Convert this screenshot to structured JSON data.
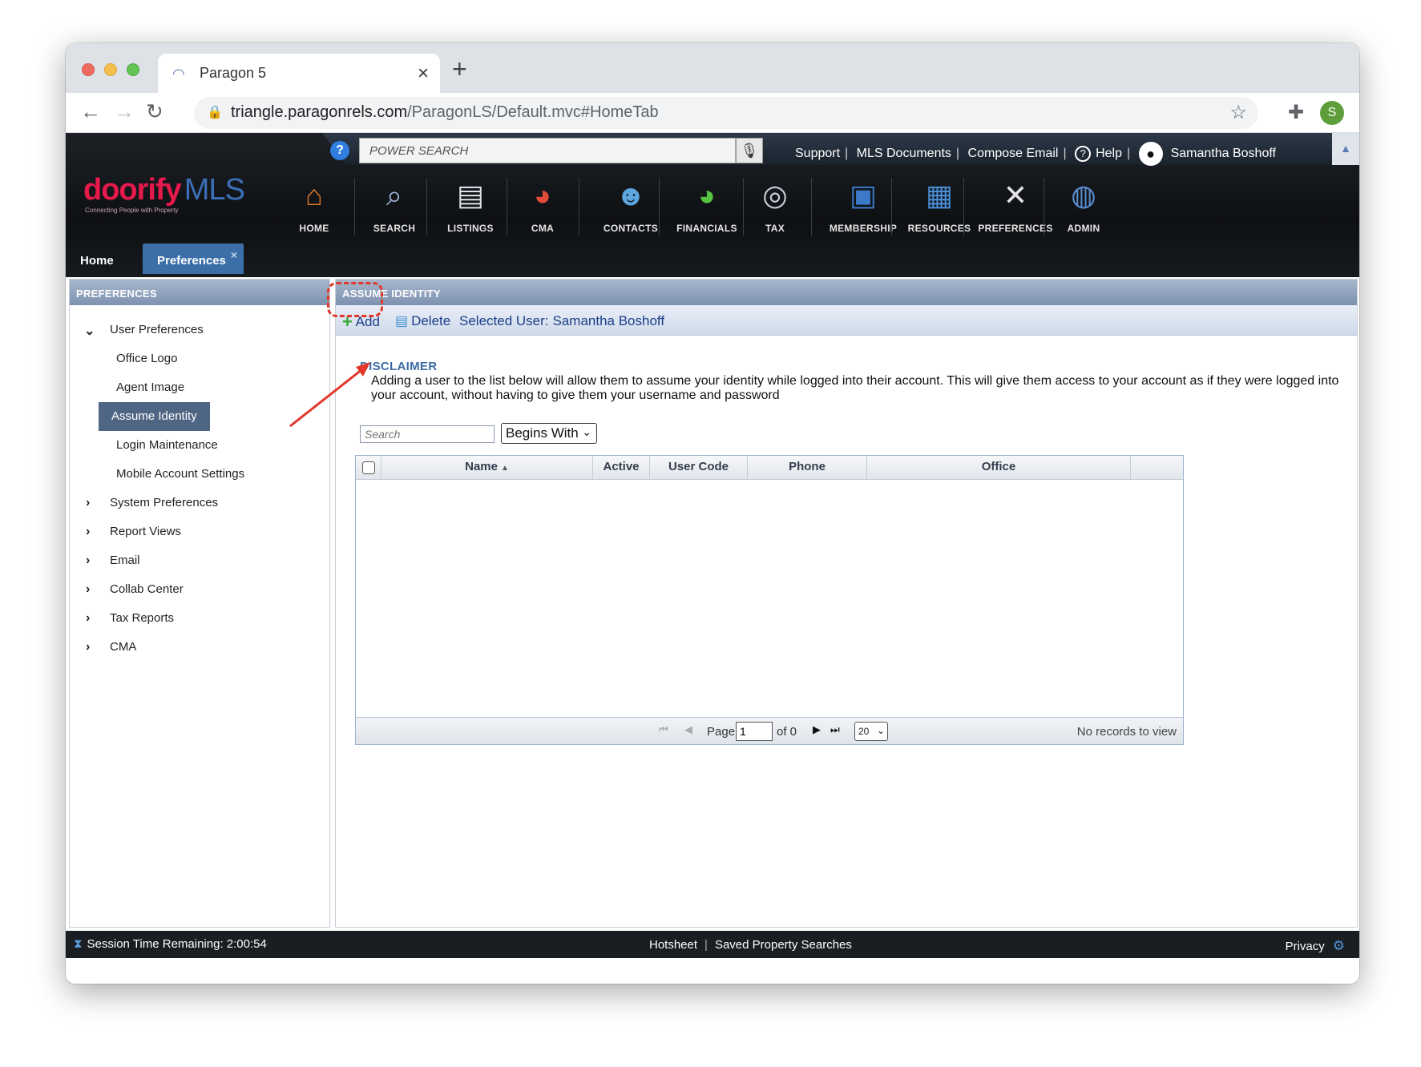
{
  "browser": {
    "tab_title": "Paragon 5",
    "url_host": "triangle.paragonrels.com",
    "url_path": "/ParagonLS/Default.mvc#HomeTab",
    "profile_initial": "S"
  },
  "header": {
    "power_search_placeholder": "POWER SEARCH",
    "links": [
      "Support",
      "MLS Documents",
      "Compose Email"
    ],
    "help_label": "Help",
    "user_name": "Samantha Boshoff",
    "logo_primary": "doorify",
    "logo_secondary": "MLS",
    "logo_tagline": "Connecting People with Property"
  },
  "modules": [
    {
      "label": "HOME",
      "icon": "house-icon",
      "color": "#d9772a"
    },
    {
      "label": "SEARCH",
      "icon": "magnifier-icon",
      "color": "#9fb7d8"
    },
    {
      "label": "LISTINGS",
      "icon": "document-icon",
      "color": "#dfe3ea"
    },
    {
      "label": "CMA",
      "icon": "pie-chart-icon",
      "color": "#e24a3a"
    },
    {
      "label": "CONTACTS",
      "icon": "people-icon",
      "color": "#5ea6e0"
    },
    {
      "label": "FINANCIALS",
      "icon": "pie-chart-icon",
      "color": "#57c443"
    },
    {
      "label": "TAX",
      "icon": "coins-icon",
      "color": "#c7ced8"
    },
    {
      "label": "MEMBERSHIP",
      "icon": "monitor-icon",
      "color": "#3c79c8"
    },
    {
      "label": "RESOURCES",
      "icon": "drawers-icon",
      "color": "#4a90d9"
    },
    {
      "label": "PREFERENCES",
      "icon": "tools-icon",
      "color": "#e6e6e6"
    },
    {
      "label": "ADMIN",
      "icon": "globe-icon",
      "color": "#5b8fd0"
    }
  ],
  "app_tabs": {
    "home": "Home",
    "preferences": "Preferences",
    "close": "×"
  },
  "left_panel": {
    "title": "PREFERENCES",
    "groups": [
      {
        "label": "User Preferences",
        "expanded": true,
        "children": [
          "Office Logo",
          "Agent Image",
          "Assume Identity",
          "Login Maintenance",
          "Mobile Account Settings"
        ],
        "selected": "Assume Identity"
      },
      {
        "label": "System Preferences",
        "expanded": false
      },
      {
        "label": "Report Views",
        "expanded": false
      },
      {
        "label": "Email",
        "expanded": false
      },
      {
        "label": "Collab Center",
        "expanded": false
      },
      {
        "label": "Tax Reports",
        "expanded": false
      },
      {
        "label": "CMA",
        "expanded": false
      }
    ]
  },
  "main": {
    "title": "ASSUME IDENTITY",
    "toolbar": {
      "add": "Add",
      "delete": "Delete",
      "selected_user_label": "Selected User:",
      "selected_user_name": "Samantha Boshoff"
    },
    "disclaimer_title": "DISCLAIMER",
    "disclaimer_text": "Adding a user to the list below will allow them to assume your identity while logged into their account. This will give them access to your account as if they were logged into your account, without having to give them your username and password",
    "search_placeholder": "Search",
    "search_mode": "Begins With",
    "grid": {
      "columns": [
        "Name",
        "Active",
        "User Code",
        "Phone",
        "Office"
      ],
      "sort_column": "Name",
      "rows": [],
      "pager": {
        "page_label": "Page",
        "page_value": "1",
        "of_label": "of 0",
        "page_size": "20",
        "status": "No records to view"
      }
    }
  },
  "status_bar": {
    "session": "Session Time Remaining: 2:00:54",
    "links": [
      "Hotsheet",
      "Saved Property Searches"
    ],
    "privacy": "Privacy"
  },
  "annotation": {
    "color": "#e2382b"
  }
}
